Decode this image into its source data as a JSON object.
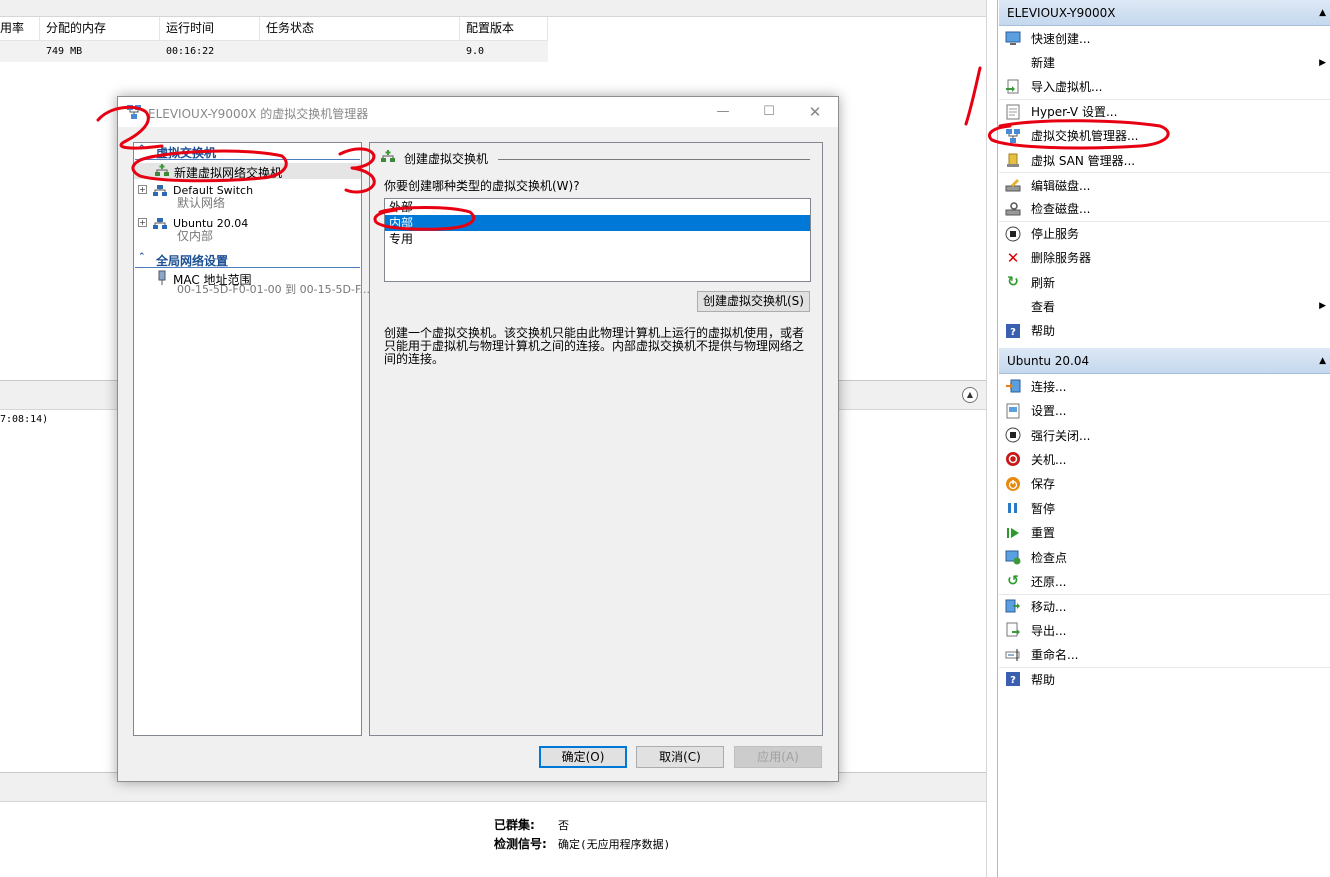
{
  "vm_table": {
    "headers": [
      "用率",
      "分配的内存",
      "运行时间",
      "任务状态",
      "配置版本"
    ],
    "row": [
      "",
      "749 MB",
      "00:16:22",
      "",
      "9.0"
    ]
  },
  "log_snippet": "7:08:14)",
  "details": [
    {
      "label": "已群集:",
      "value": "否"
    },
    {
      "label": "检测信号:",
      "value": "确定(无应用程序数据)"
    }
  ],
  "actions_pane": {
    "host_header": "ELEVIOUX-Y9000X",
    "host_items": [
      {
        "label": "快速创建...",
        "icon": "quick-create-icon"
      },
      {
        "label": "新建",
        "icon": "",
        "submenu": true
      },
      {
        "label": "导入虚拟机...",
        "icon": "import-icon"
      },
      {
        "label": "Hyper-V 设置...",
        "icon": "settings-doc-icon"
      },
      {
        "label": "虚拟交换机管理器...",
        "icon": "switch-manager-icon"
      },
      {
        "label": "虚拟 SAN 管理器...",
        "icon": "san-icon"
      },
      {
        "label": "编辑磁盘...",
        "icon": "edit-disk-icon"
      },
      {
        "label": "检查磁盘...",
        "icon": "inspect-disk-icon"
      },
      {
        "label": "停止服务",
        "icon": "stop-icon"
      },
      {
        "label": "删除服务器",
        "icon": "delete-icon"
      },
      {
        "label": "刷新",
        "icon": "refresh-icon"
      },
      {
        "label": "查看",
        "icon": "",
        "submenu": true
      },
      {
        "label": "帮助",
        "icon": "help-icon"
      }
    ],
    "vm_header": "Ubuntu 20.04",
    "vm_items": [
      {
        "label": "连接...",
        "icon": "connect-icon"
      },
      {
        "label": "设置...",
        "icon": "vm-settings-icon"
      },
      {
        "label": "强行关闭...",
        "icon": "turn-off-icon"
      },
      {
        "label": "关机...",
        "icon": "shutdown-icon"
      },
      {
        "label": "保存",
        "icon": "save-icon"
      },
      {
        "label": "暂停",
        "icon": "pause-icon"
      },
      {
        "label": "重置",
        "icon": "reset-icon"
      },
      {
        "label": "检查点",
        "icon": "checkpoint-icon"
      },
      {
        "label": "还原...",
        "icon": "revert-icon"
      },
      {
        "label": "移动...",
        "icon": "move-icon"
      },
      {
        "label": "导出...",
        "icon": "export-icon"
      },
      {
        "label": "重命名...",
        "icon": "rename-icon"
      },
      {
        "label": "帮助",
        "icon": "help-icon"
      }
    ]
  },
  "dialog": {
    "title": "ELEVIOUX-Y9000X 的虚拟交换机管理器",
    "tree": {
      "section1": "虚拟交换机",
      "new_switch": "新建虚拟网络交换机",
      "switches": [
        {
          "name": "Default Switch",
          "type": "默认网络"
        },
        {
          "name": "Ubuntu 20.04",
          "type": "仅内部"
        }
      ],
      "section2": "全局网络设置",
      "mac_label": "MAC 地址范围",
      "mac_value": "00-15-5D-F0-01-00 到 00-15-5D-F..."
    },
    "panel": {
      "heading": "创建虚拟交换机",
      "question": "你要创建哪种类型的虚拟交换机(W)?",
      "options": [
        "外部",
        "内部",
        "专用"
      ],
      "selected": "内部",
      "create_button": "创建虚拟交换机(S)",
      "description": "创建一个虚拟交换机。该交换机只能由此物理计算机上运行的虚拟机使用，或者只能用于虚拟机与物理计算机之间的连接。内部虚拟交换机不提供与物理网络之间的连接。"
    },
    "buttons": {
      "ok": "确定(O)",
      "cancel": "取消(C)",
      "apply": "应用(A)"
    }
  },
  "annotations": [
    "1",
    "2",
    "3"
  ],
  "colors": {
    "selection": "#0078d7",
    "tree_section": "#1c4f94",
    "annotation": "#e60012",
    "pane_header": "#c5d8ee"
  }
}
